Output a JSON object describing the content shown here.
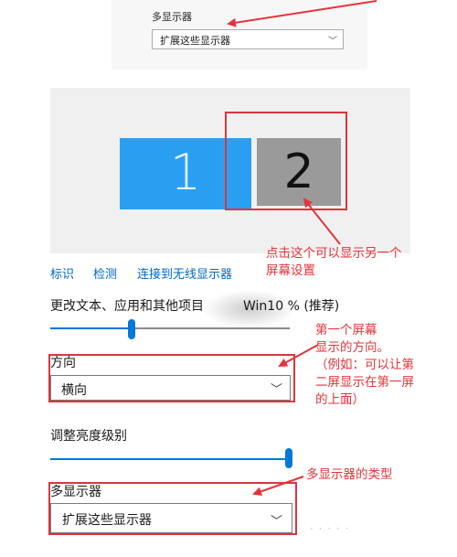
{
  "top": {
    "label": "多显示器",
    "select_value": "扩展这些显示器"
  },
  "display": {
    "monitor_1": "1",
    "monitor_2": "2"
  },
  "links": {
    "identify": "标识",
    "detect": "检测",
    "wireless": "连接到无线显示器"
  },
  "scale": {
    "label": "更改文本、应用和其他项目",
    "value": "Win10 % (推荐)",
    "level_fraction": 0.35
  },
  "orientation": {
    "label": "方向",
    "value": "横向"
  },
  "brightness": {
    "label": "调整亮度级别",
    "level_fraction": 1.0
  },
  "multi_display": {
    "label": "多显示器",
    "value": "扩展这些显示器"
  },
  "annotations": {
    "monitor2_line1": "点击这个可以显示另一个",
    "monitor2_line2": "屏幕设置",
    "orient_line1": "第一个屏幕",
    "orient_line2": "显示的方向。",
    "orient_line3": "（例如：可以让第",
    "orient_line4": "二屏显示在第一屏",
    "orient_line5": "的上面）",
    "multi": "多显示器的类型"
  },
  "colors": {
    "accent": "#0078d7",
    "monitor_selected": "#2a9ff2",
    "monitor_other": "#9a9a9a",
    "annotation": "#e5333a"
  }
}
